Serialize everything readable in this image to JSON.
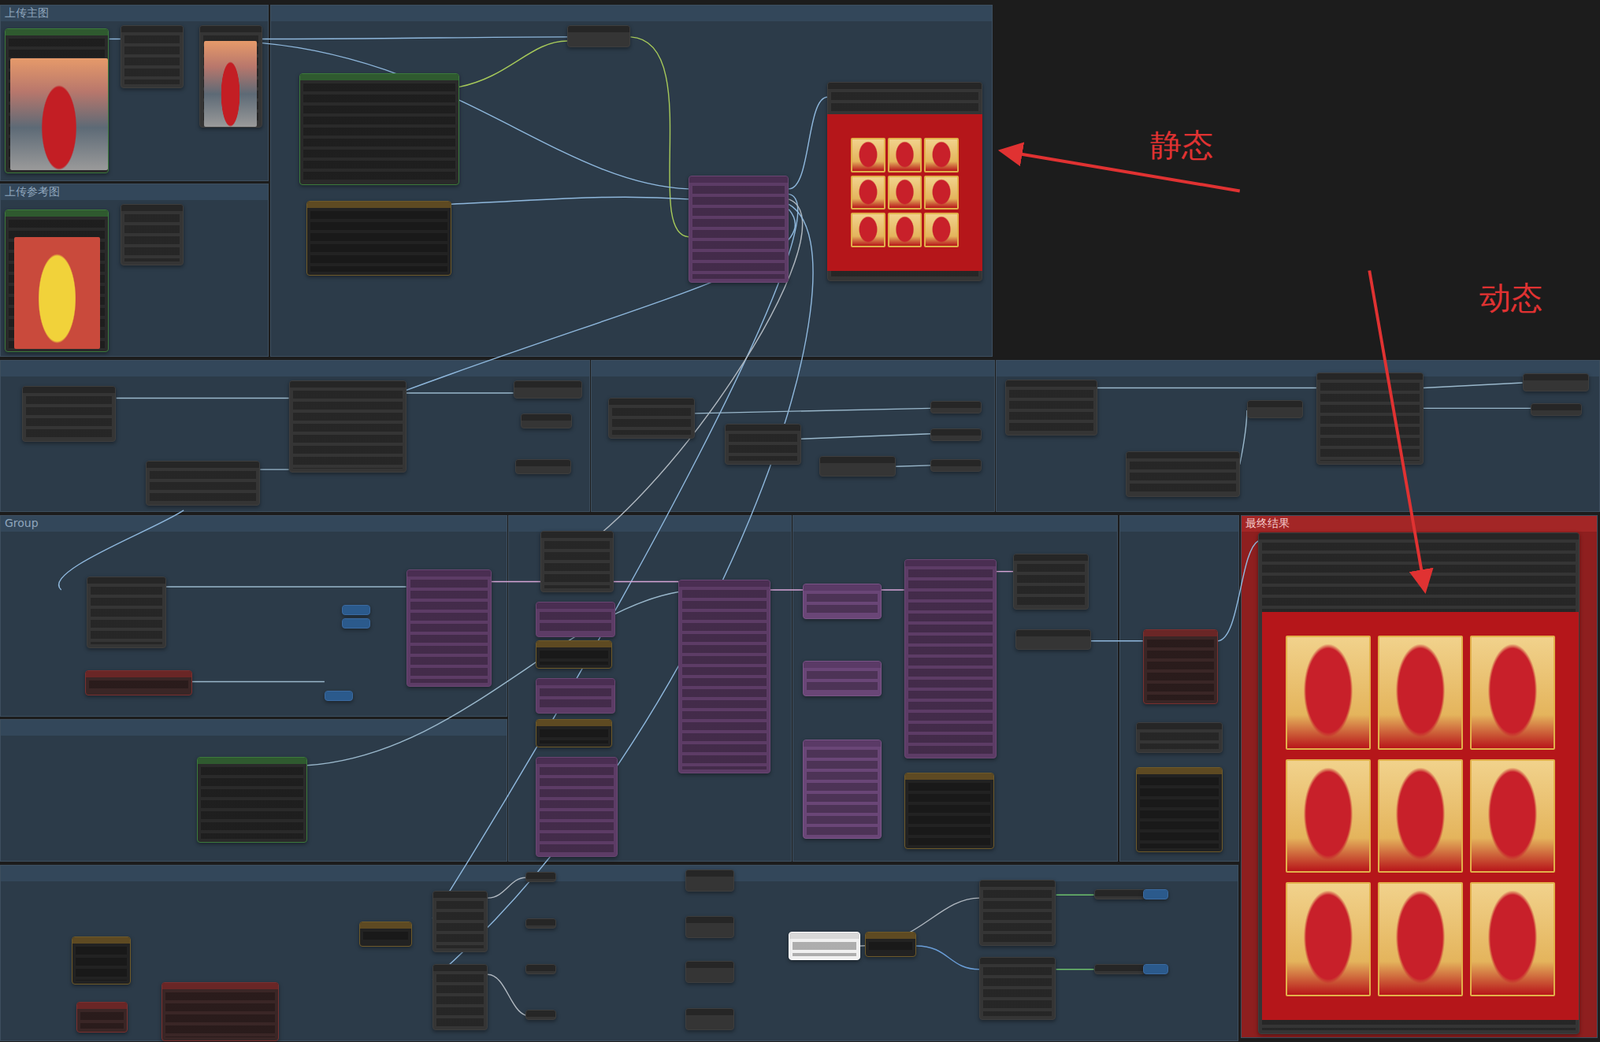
{
  "canvas": {
    "groups": [
      {
        "title": "",
        "color": "#2c3b49"
      },
      {
        "title": "上传主图",
        "color": "#2c3b49"
      },
      {
        "title": "上传参考图",
        "color": "#2c3b49"
      },
      {
        "title": "",
        "color": "#2c3b49"
      },
      {
        "title": "",
        "color": "#2c3b49"
      },
      {
        "title": "",
        "color": "#2c3b49"
      },
      {
        "title": "Group",
        "color": "#2c3b49"
      },
      {
        "title": "",
        "color": "#2c3b49"
      },
      {
        "title": "",
        "color": "#2c3b49"
      },
      {
        "title": "",
        "color": "#2c3b49"
      },
      {
        "title": "",
        "color": "#2c3b49"
      },
      {
        "title": "",
        "color": "#2c3b49"
      },
      {
        "title": "最终结果",
        "color": "#8e1f1f"
      }
    ],
    "annotations": [
      {
        "label": "静态"
      },
      {
        "label": "动态"
      }
    ]
  }
}
